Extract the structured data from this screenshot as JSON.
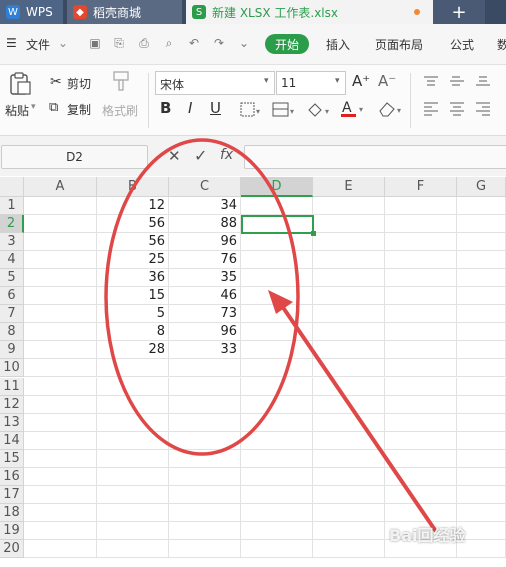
{
  "tabs": {
    "wps": "WPS",
    "store": "稻壳商城",
    "file": "新建 XLSX 工作表.xlsx",
    "plus": "+"
  },
  "menu": {
    "file": "文件",
    "start": "开始",
    "insert": "插入",
    "page_layout": "页面布局",
    "formula": "公式",
    "data": "数"
  },
  "ribbon": {
    "paste": "粘贴",
    "cut": "剪切",
    "copy": "复制",
    "format_painter": "格式刷",
    "font_name": "宋体",
    "font_size": "11",
    "bold": "B",
    "italic": "I",
    "underline": "U",
    "font_color_hex": "#e02020",
    "increase_font": "A⁺",
    "decrease_font": "A⁻"
  },
  "formula_bar": {
    "name_box": "D2",
    "cancel": "✕",
    "confirm": "✓",
    "fx": "fx",
    "value": ""
  },
  "sheet": {
    "columns": [
      "A",
      "B",
      "C",
      "D",
      "E",
      "F",
      "G"
    ],
    "rows": [
      "1",
      "2",
      "3",
      "4",
      "5",
      "6",
      "7",
      "8",
      "9",
      "10",
      "11",
      "12",
      "13",
      "14",
      "15",
      "16",
      "17",
      "18",
      "19",
      "20"
    ],
    "selected_cell": "D2",
    "col_b": [
      "12",
      "56",
      "56",
      "25",
      "36",
      "15",
      "5",
      "8",
      "28"
    ],
    "col_c": [
      "34",
      "88",
      "96",
      "76",
      "35",
      "46",
      "73",
      "96",
      "33"
    ]
  },
  "annotation": {
    "color": "#e04848"
  },
  "watermark": "Bai回经验"
}
